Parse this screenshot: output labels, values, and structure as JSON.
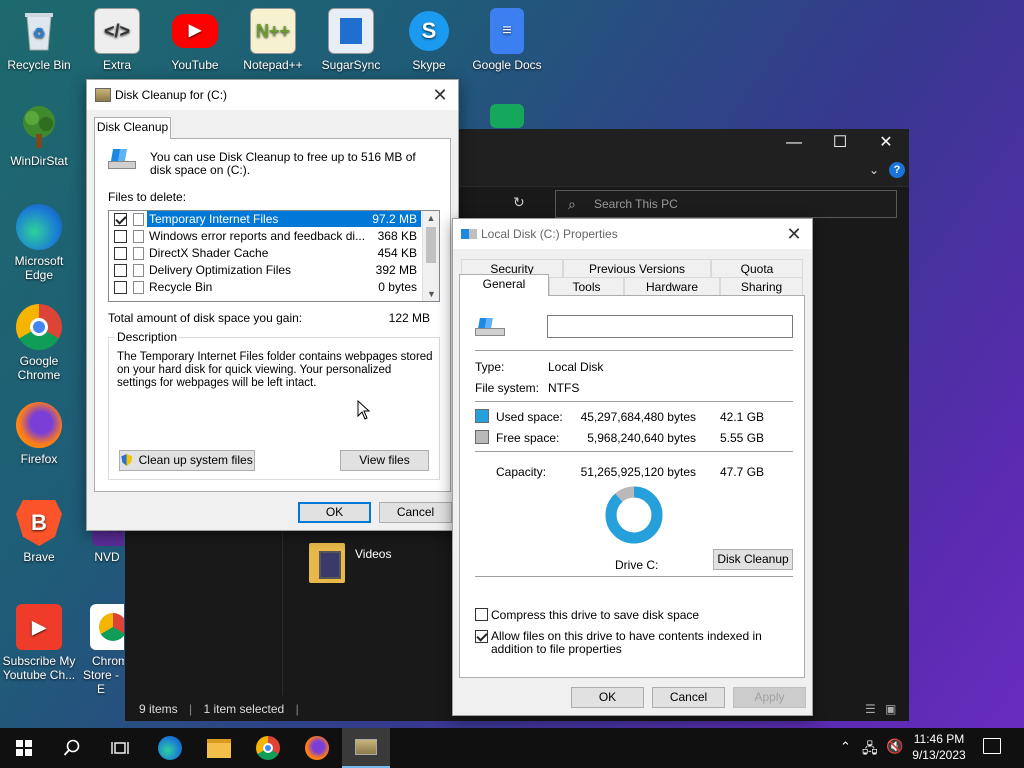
{
  "desktop": {
    "icons": [
      {
        "label": "Recycle Bin",
        "icon": "recycle-bin-icon"
      },
      {
        "label": "Extra",
        "icon": "code-file-icon"
      },
      {
        "label": "YouTube",
        "icon": "youtube-icon"
      },
      {
        "label": "Notepad++",
        "icon": "notepad-plus-plus-icon"
      },
      {
        "label": "SugarSync",
        "icon": "sugarsync-icon"
      },
      {
        "label": "Skype",
        "icon": "skype-icon"
      },
      {
        "label": "Google Docs",
        "icon": "google-docs-icon"
      },
      {
        "label": "WinDirStat",
        "icon": "windirstat-icon"
      },
      {
        "label": "Microsoft Edge",
        "icon": "edge-icon"
      },
      {
        "label": "Google Chrome",
        "icon": "chrome-icon"
      },
      {
        "label": "Firefox",
        "icon": "firefox-icon"
      },
      {
        "label": "Brave",
        "icon": "brave-icon"
      },
      {
        "label": "NVD",
        "icon": "nvda-icon"
      },
      {
        "label": "Subscribe My Youtube Ch...",
        "icon": "youtube-subscribe-icon"
      },
      {
        "label": "Chrome Store - E",
        "icon": "chrome-store-icon"
      }
    ]
  },
  "explorer": {
    "search_placeholder": "Search This PC",
    "videos_label": "Videos",
    "status_items": "9 items",
    "status_selected": "1 item selected",
    "controls": {
      "minimize": "—",
      "maximize": "☐",
      "close": "✕"
    }
  },
  "disk_cleanup": {
    "title": "Disk Cleanup for  (C:)",
    "tab": "Disk Cleanup",
    "intro": "You can use Disk Cleanup to free up to 516 MB of disk space on  (C:).",
    "files_to_delete_label": "Files to delete:",
    "files": [
      {
        "name": "Temporary Internet Files",
        "size": "97.2 MB",
        "checked": true,
        "selected": true
      },
      {
        "name": "Windows error reports and feedback di...",
        "size": "368 KB",
        "checked": false,
        "selected": false
      },
      {
        "name": "DirectX Shader Cache",
        "size": "454 KB",
        "checked": false,
        "selected": false
      },
      {
        "name": "Delivery Optimization Files",
        "size": "392 MB",
        "checked": false,
        "selected": false
      },
      {
        "name": "Recycle Bin",
        "size": "0 bytes",
        "checked": false,
        "selected": false
      }
    ],
    "total_label": "Total amount of disk space you gain:",
    "total_value": "122 MB",
    "description_label": "Description",
    "description_text": "The Temporary Internet Files folder contains webpages stored on your hard disk for quick viewing. Your personalized settings for webpages will be left intact.",
    "clean_system_label": "Clean up system files",
    "view_files_label": "View files",
    "ok_label": "OK",
    "cancel_label": "Cancel",
    "close_glyph": "✕"
  },
  "properties": {
    "title": "Local Disk (C:) Properties",
    "tabs_row1": [
      "Security",
      "Previous Versions",
      "Quota"
    ],
    "tabs_row2": [
      "General",
      "Tools",
      "Hardware",
      "Sharing"
    ],
    "name_value": "",
    "type_label": "Type:",
    "type_value": "Local Disk",
    "fs_label": "File system:",
    "fs_value": "NTFS",
    "used_label": "Used space:",
    "used_bytes": "45,297,684,480 bytes",
    "used_gb": "42.1 GB",
    "free_label": "Free space:",
    "free_bytes": "5,968,240,640 bytes",
    "free_gb": "5.55 GB",
    "capacity_label": "Capacity:",
    "capacity_bytes": "51,265,925,120 bytes",
    "capacity_gb": "47.7 GB",
    "drive_label": "Drive C:",
    "disk_cleanup_label": "Disk Cleanup",
    "compress_label": "Compress this drive to save disk space",
    "compress_checked": false,
    "index_label": "Allow files on this drive to have contents indexed in addition to file properties",
    "index_checked": true,
    "ok_label": "OK",
    "cancel_label": "Cancel",
    "apply_label": "Apply",
    "used_fraction": 0.8836,
    "colors": {
      "used": "#26a0da",
      "free": "#b9b9b9"
    },
    "close_glyph": "✕"
  },
  "taskbar": {
    "time": "11:46 PM",
    "date": "9/13/2023",
    "items": [
      "start-icon",
      "search-icon",
      "task-view-icon",
      "edge-icon",
      "file-explorer-icon",
      "chrome-icon",
      "firefox-icon",
      "disk-cleanup-icon"
    ]
  }
}
